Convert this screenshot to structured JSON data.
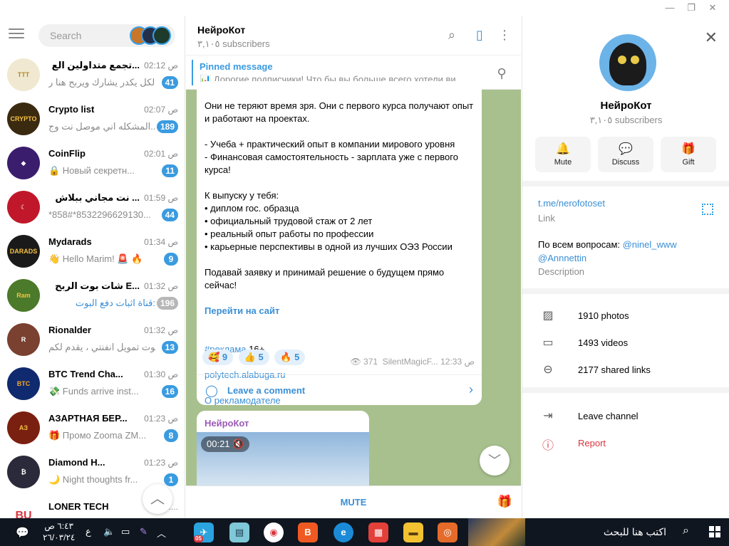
{
  "search": {
    "placeholder": "Search"
  },
  "chats": [
    {
      "title": "تجمع متداولين الع...",
      "time": "ص 02:12",
      "preview": "الكل يكدر يشارك ويربح هنا ر...",
      "badge": "41",
      "muted": false,
      "color": "#f0e8d0"
    },
    {
      "title": "Crypto list",
      "time": "ص 02:07",
      "preview": "المشكله اني موصل نت وج...",
      "badge": "189",
      "muted": false,
      "color": "#3a2a10"
    },
    {
      "title": "CoinFlip",
      "time": "ص 02:01",
      "preview": "🔒 Новый секретн...",
      "badge": "11",
      "muted": false,
      "color": "#3b1d6e"
    },
    {
      "title": "نت مجاني ببلاش ...",
      "time": "ص 01:59",
      "preview": "*858#*8532296629130...",
      "badge": "44",
      "muted": false,
      "color": "#c0182a"
    },
    {
      "title": "Mydarads",
      "time": "ص 01:34",
      "preview": "👋 Hello Marim! 🚨 🔥",
      "badge": "9",
      "muted": false,
      "color": "#1a1a1a"
    },
    {
      "title": "شات بوت الربح E...",
      "time": "ص 01:32",
      "preview": "قناة اثبات دفع البوت:",
      "badge": "196",
      "muted": true,
      "color": "#4a7a2a"
    },
    {
      "title": "Rionalder",
      "time": "ص 01:32",
      "preview": "بوت تمويل انفنتي ، يقدم لكم...",
      "badge": "13",
      "muted": false,
      "color": "#7a4030"
    },
    {
      "title": "BTC Trend Cha...",
      "time": "ص 01:30",
      "preview": "💸 Funds arrive inst...",
      "badge": "16",
      "muted": false,
      "color": "#0f2a6e"
    },
    {
      "title": "АЗАРТНАЯ БЕР...",
      "time": "ص 01:23",
      "preview": "🎁 Промо Zooma ZM...",
      "badge": "8",
      "muted": false,
      "color": "#7a2010"
    },
    {
      "title": "Diamond H...",
      "time": "ص 01:23",
      "preview": "🌙 Night thoughts fr...",
      "badge": "1",
      "muted": false,
      "color": "#2a2a3a"
    },
    {
      "title": "LONER TECH",
      "time": "ص 01:...",
      "preview": "",
      "badge": "",
      "muted": false,
      "color": "#ffffff"
    }
  ],
  "channel": {
    "name": "НейроКот",
    "subscribers": "٣,١٠٥ subscribers"
  },
  "pinned": {
    "title": "Pinned message",
    "text": "📊 Дорогие подписчики! Что бы вы больше всего хотели ви..."
  },
  "post": {
    "text": "Они не теряют время зря. Они с первого курса получают опыт и работают на проектах.\n\n- Учеба + практический опыт в компании мирового уровня\n- Финансовая самостоятельность - зарплата уже с первого курса!\n\nК выпуску у тебя:\n• диплом гос. образца\n• официальный трудовой стаж от 2 лет\n• реальный опыт работы по профессии\n• карьерные перспективы в одной из лучших ОЭЗ России\n\nПодавай заявку и принимай решение о будущем прямо сейчас!",
    "cta": "Перейти на сайт",
    "hashtag": "#реклама",
    "age": " 16+",
    "site": "polytech.alabuga.ru",
    "about_ad": "О рекламодателе",
    "reactions": [
      {
        "emoji": "🥰",
        "count": "9"
      },
      {
        "emoji": "👍",
        "count": "5"
      },
      {
        "emoji": "🔥",
        "count": "5"
      }
    ],
    "views": "371",
    "author": "SilentMagicF...",
    "time": "12:33 ص",
    "comment": "Leave a comment"
  },
  "post2": {
    "author": "НейроКот",
    "duration": "00:21"
  },
  "mute_label": "MUTE",
  "profile": {
    "name": "НейроКот",
    "subscribers": "٣,١٠٥ subscribers",
    "buttons": [
      "Mute",
      "Discuss",
      "Gift"
    ],
    "link": "t.me/nerofotoset",
    "link_label": "Link",
    "desc_prefix": "По всем вопросам: ",
    "desc_handle1": "@ninel_www",
    "desc_handle2": "@Annnettin",
    "desc_label": "Description",
    "photos": "1910 photos",
    "videos": "1493 videos",
    "links": "2177 shared links",
    "leave": "Leave channel",
    "report": "Report"
  },
  "taskbar": {
    "search": "اكتب هنا للبحث",
    "time": "٦:٤٣ ص",
    "date": "٢٦/٠٣/٢٤",
    "lang": "ع",
    "telegram_badge": "05"
  }
}
